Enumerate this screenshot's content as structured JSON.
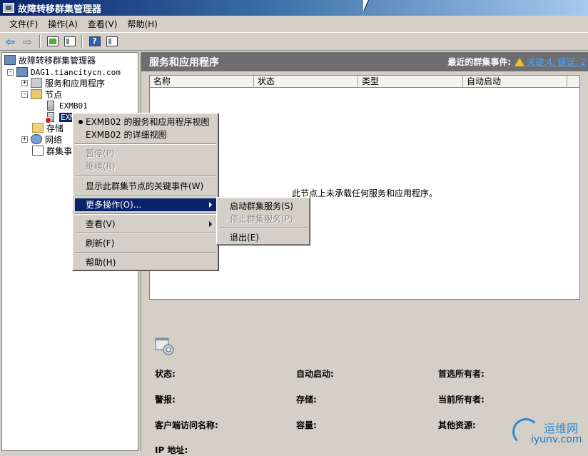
{
  "window": {
    "title": "故障转移群集管理器"
  },
  "menubar": [
    "文件(F)",
    "操作(A)",
    "查看(V)",
    "帮助(H)"
  ],
  "toolbar": {
    "icons": [
      "back-arrow-icon",
      "forward-arrow-icon",
      "up-folder-icon",
      "show-hide-tree-icon",
      "help-icon",
      "action-pane-icon"
    ]
  },
  "tree": {
    "root": "故障转移群集管理器",
    "cluster": "DAG1.tiancitycn.com",
    "services": "服务和应用程序",
    "nodes": "节点",
    "node1": "EXMB01",
    "node2": "EXMB02",
    "node2_visible": "EXM",
    "storage": "存储",
    "network": "网络",
    "events": "群集事"
  },
  "right": {
    "header_title": "服务和应用程序",
    "events_label": "最近的群集事件:",
    "events_link": "关键:4, 错误: 2",
    "columns": [
      "名称",
      "状态",
      "类型",
      "自动启动"
    ],
    "empty_message": "此节点上未承载任何服务和应用程序。",
    "details": {
      "status": "状态:",
      "autostart": "自动启动:",
      "preferred_owner": "首选所有者:",
      "alerts": "警报:",
      "storage": "存储:",
      "current_owner": "当前所有者:",
      "client_access": "客户端访问名称:",
      "capacity": "容量:",
      "other_resources": "其他资源:",
      "ip": "IP 地址:"
    }
  },
  "context_menu": {
    "items": [
      "EXMB02 的服务和应用程序视图",
      "EXMB02 的详细视图",
      "暂停(P)",
      "继续(R)",
      "显示此群集节点的关键事件(W)",
      "更多操作(O)...",
      "查看(V)",
      "刷新(F)",
      "帮助(H)"
    ]
  },
  "submenu": {
    "items": [
      "启动群集服务(S)",
      "停止群集服务(P)",
      "退出(E)"
    ]
  },
  "watermark": {
    "line1": "运维网",
    "line2": "iyunv.com"
  },
  "colors": {
    "selection": "#0a246a",
    "header_bg": "#6e6e6e",
    "link": "#4aa3ff",
    "window_bg": "#d4d0c8"
  }
}
